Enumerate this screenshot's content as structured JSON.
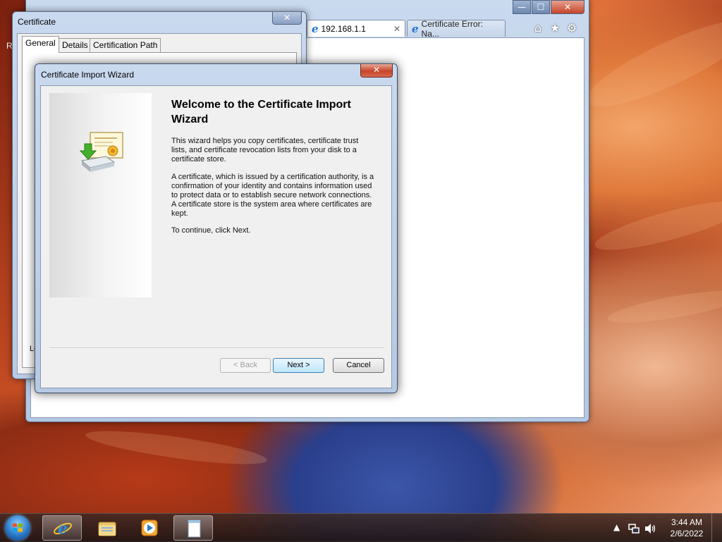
{
  "browser": {
    "tabs": [
      {
        "label": "192.168.1.1",
        "close": "✕"
      },
      {
        "label": "Certificate Error: Na..."
      }
    ],
    "window_controls": {
      "minimize": "—",
      "maximize": "☐",
      "close": "✕"
    },
    "toolbar_icons": [
      "home-icon",
      "favorites-star-icon",
      "tools-gear-icon"
    ]
  },
  "certificate_dialog": {
    "title": "Certificate",
    "close": "✕",
    "tabs": [
      "General",
      "Details",
      "Certification Path"
    ],
    "selected_tab": "General",
    "left_edge_char": "R",
    "partial_label": "Le"
  },
  "wizard": {
    "title": "Certificate Import Wizard",
    "close": "✕",
    "heading": "Welcome to the Certificate Import Wizard",
    "para1": "This wizard helps you copy certificates, certificate trust lists, and certificate revocation lists from your disk to a certificate store.",
    "para2": "A certificate, which is issued by a certification authority, is a confirmation of your identity and contains information used to protect data or to establish secure network connections. A certificate store is the system area where certificates are kept.",
    "para3": "To continue, click Next.",
    "buttons": {
      "back": "< Back",
      "next": "Next >",
      "cancel": "Cancel"
    },
    "back_disabled": true
  },
  "taskbar": {
    "pinned": [
      "internet-explorer",
      "windows-explorer",
      "media-player",
      "notepad"
    ],
    "active": "notepad",
    "clock_time": "3:44 AM",
    "clock_date": "2/6/2022",
    "tray_icons": [
      "show-hidden-icons-arrow",
      "network-icon",
      "volume-icon"
    ]
  },
  "colors": {
    "accent_blue": "#1e6fd0",
    "close_red": "#c7432a",
    "dialog_face": "#f0f0f0"
  }
}
